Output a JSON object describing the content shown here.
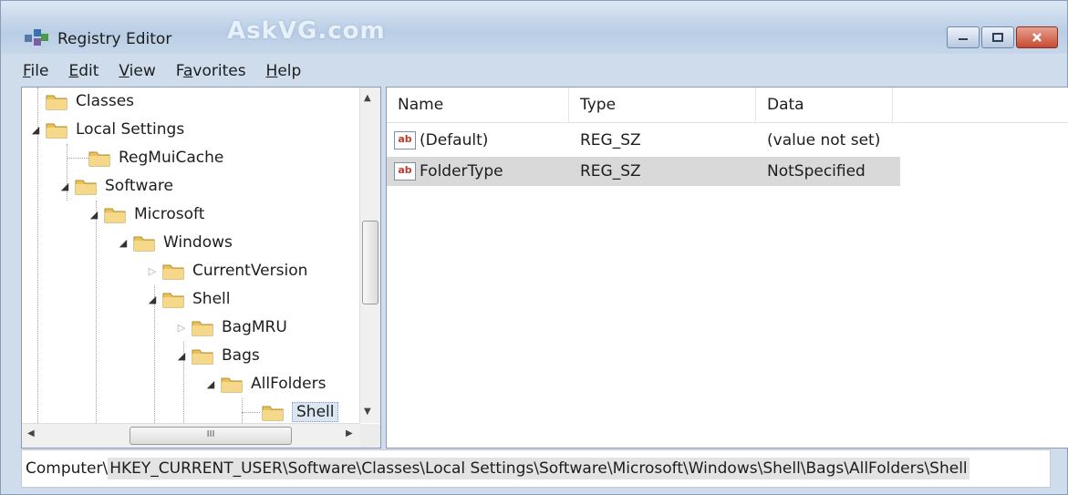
{
  "window": {
    "title": "Registry Editor",
    "watermark": "AskVG.com"
  },
  "menu": [
    {
      "u": "F",
      "rest": "ile"
    },
    {
      "u": "E",
      "rest": "dit"
    },
    {
      "u": "V",
      "rest": "iew"
    },
    {
      "pre": "F",
      "u": "a",
      "rest": "vorites"
    },
    {
      "u": "H",
      "rest": "elp"
    }
  ],
  "tree": {
    "nodes": [
      {
        "label": "Classes",
        "expander": "none"
      },
      {
        "label": "Local Settings",
        "expander": "expanded"
      },
      {
        "label": "RegMuiCache",
        "expander": "none"
      },
      {
        "label": "Software",
        "expander": "expanded"
      },
      {
        "label": "Microsoft",
        "expander": "expanded"
      },
      {
        "label": "Windows",
        "expander": "expanded"
      },
      {
        "label": "CurrentVersion",
        "expander": "collapsed"
      },
      {
        "label": "Shell",
        "expander": "expanded"
      },
      {
        "label": "BagMRU",
        "expander": "collapsed"
      },
      {
        "label": "Bags",
        "expander": "expanded"
      },
      {
        "label": "AllFolders",
        "expander": "expanded"
      },
      {
        "label": "Shell",
        "expander": "none",
        "selected": true
      }
    ],
    "hscroll_thumb_glyph": "III"
  },
  "list": {
    "columns": [
      "Name",
      "Type",
      "Data"
    ],
    "rows": [
      {
        "name": "(Default)",
        "type": "REG_SZ",
        "data": "(value not set)",
        "icon": "string-value-icon"
      },
      {
        "name": "FolderType",
        "type": "REG_SZ",
        "data": "NotSpecified",
        "icon": "string-value-icon",
        "selected": true
      }
    ],
    "icon_text": "ab"
  },
  "status": {
    "prefix": "Computer\\",
    "path": "HKEY_CURRENT_USER\\Software\\Classes\\Local Settings\\Software\\Microsoft\\Windows\\Shell\\Bags\\AllFolders\\Shell"
  },
  "colors": {
    "folder": "#e9c25a",
    "titlebar": "#c7d7ea",
    "selection": "#d9d9d9"
  }
}
